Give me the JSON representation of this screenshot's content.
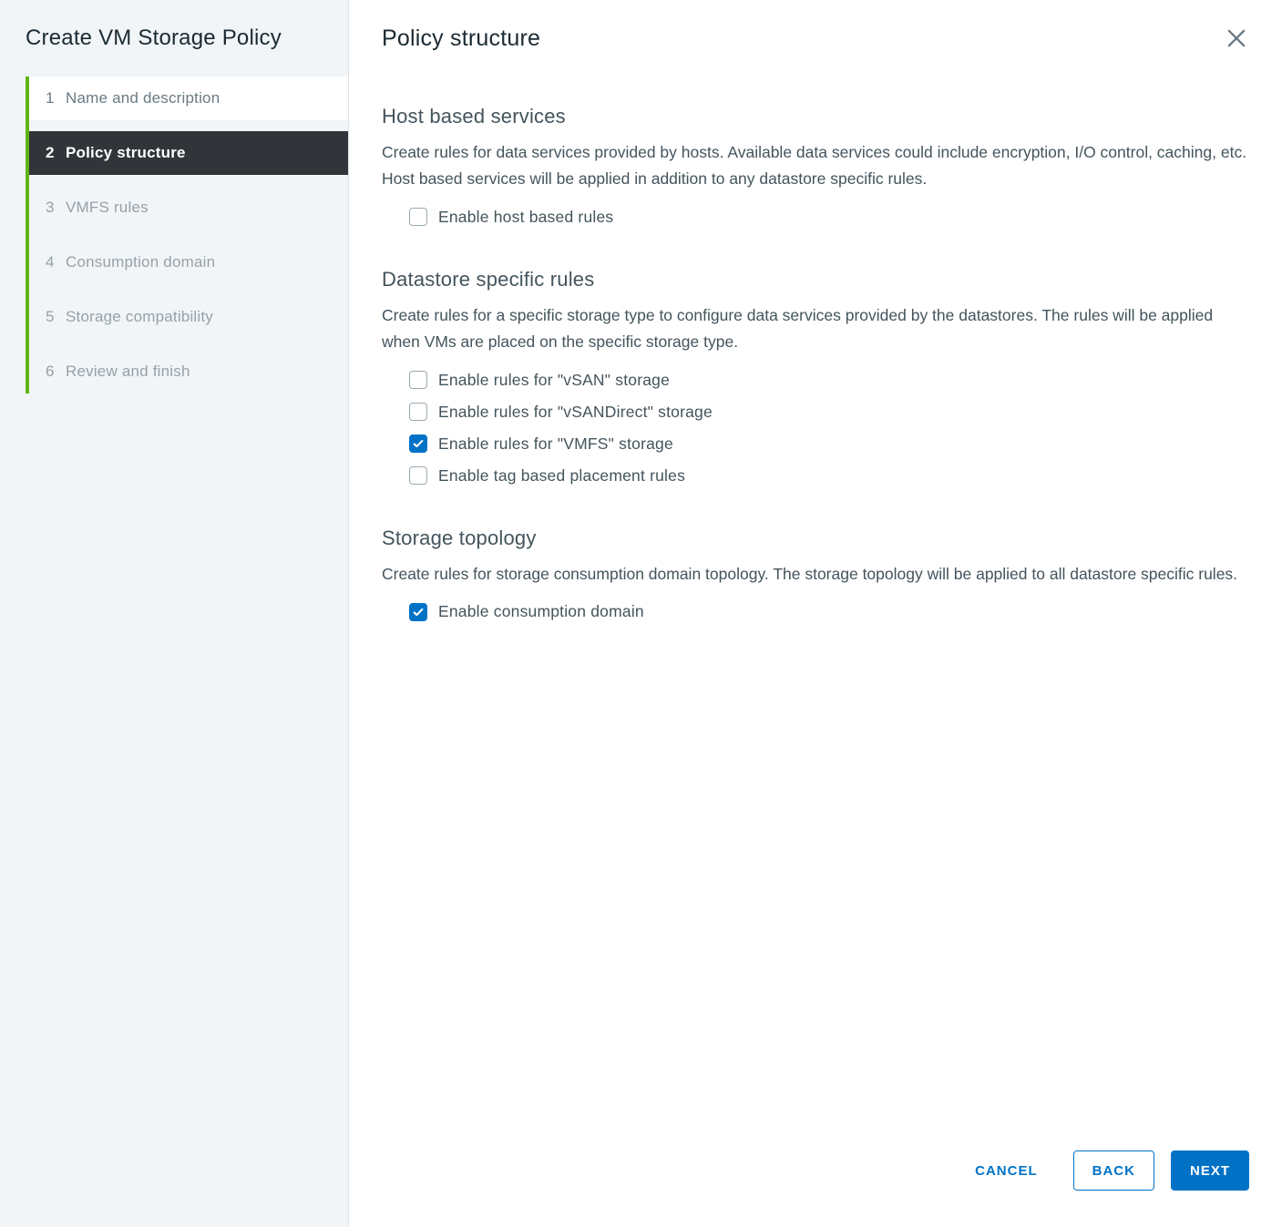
{
  "sidebar": {
    "title": "Create VM Storage Policy",
    "steps": [
      {
        "num": "1",
        "label": "Name and description",
        "state": "completed"
      },
      {
        "num": "2",
        "label": "Policy structure",
        "state": "active"
      },
      {
        "num": "3",
        "label": "VMFS rules",
        "state": "future"
      },
      {
        "num": "4",
        "label": "Consumption domain",
        "state": "future"
      },
      {
        "num": "5",
        "label": "Storage compatibility",
        "state": "future"
      },
      {
        "num": "6",
        "label": "Review and finish",
        "state": "future"
      }
    ]
  },
  "main": {
    "title": "Policy structure",
    "sections": {
      "host": {
        "heading": "Host based services",
        "text": "Create rules for data services provided by hosts. Available data services could include encryption, I/O control, caching, etc. Host based services will be applied in addition to any datastore specific rules.",
        "checkboxes": [
          {
            "id": "enable-host-rules",
            "label": "Enable host based rules",
            "checked": false
          }
        ]
      },
      "datastore": {
        "heading": "Datastore specific rules",
        "text": "Create rules for a specific storage type to configure data services provided by the datastores. The rules will be applied when VMs are placed on the specific storage type.",
        "checkboxes": [
          {
            "id": "enable-vsan",
            "label": "Enable rules for \"vSAN\" storage",
            "checked": false
          },
          {
            "id": "enable-vsandirect",
            "label": "Enable rules for \"vSANDirect\" storage",
            "checked": false
          },
          {
            "id": "enable-vmfs",
            "label": "Enable rules for \"VMFS\" storage",
            "checked": true
          },
          {
            "id": "enable-tag",
            "label": "Enable tag based placement rules",
            "checked": false
          }
        ]
      },
      "topology": {
        "heading": "Storage topology",
        "text": "Create rules for storage consumption domain topology. The storage topology will be applied to all datastore specific rules.",
        "checkboxes": [
          {
            "id": "enable-consumption-domain",
            "label": "Enable consumption domain",
            "checked": true
          }
        ]
      }
    }
  },
  "footer": {
    "cancel": "CANCEL",
    "back": "BACK",
    "next": "NEXT"
  }
}
